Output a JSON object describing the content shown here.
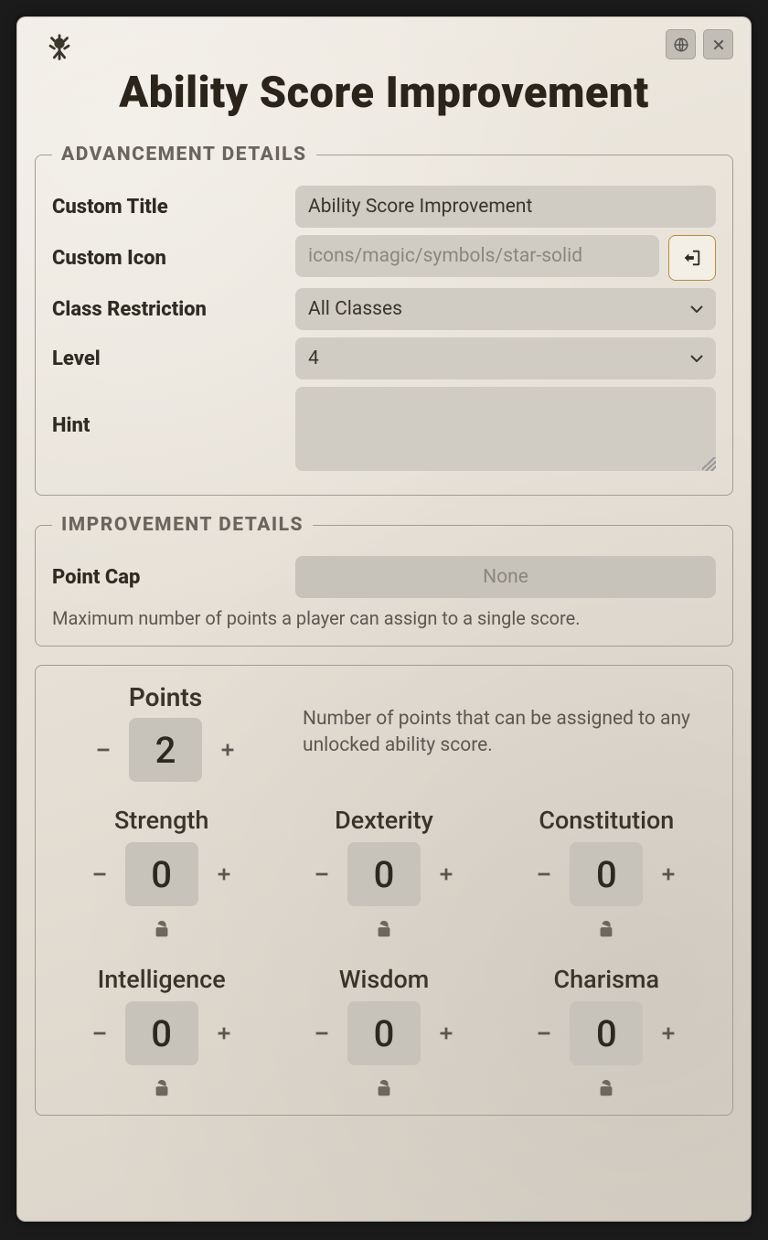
{
  "title": "Ability Score Improvement",
  "advancement": {
    "legend": "ADVANCEMENT DETAILS",
    "custom_title_label": "Custom Title",
    "custom_title_value": "Ability Score Improvement",
    "custom_icon_label": "Custom Icon",
    "custom_icon_placeholder": "icons/magic/symbols/star-solid",
    "class_restriction_label": "Class Restriction",
    "class_restriction_value": "All Classes",
    "level_label": "Level",
    "level_value": "4",
    "hint_label": "Hint"
  },
  "improvement": {
    "legend": "IMPROVEMENT DETAILS",
    "point_cap_label": "Point Cap",
    "point_cap_placeholder": "None",
    "point_cap_note": "Maximum number of points a player can assign to a single score."
  },
  "points": {
    "label": "Points",
    "value": "2",
    "note": "Number of points that can be assigned to any unlocked ability score."
  },
  "abilities": [
    {
      "name": "Strength",
      "value": "0"
    },
    {
      "name": "Dexterity",
      "value": "0"
    },
    {
      "name": "Constitution",
      "value": "0"
    },
    {
      "name": "Intelligence",
      "value": "0"
    },
    {
      "name": "Wisdom",
      "value": "0"
    },
    {
      "name": "Charisma",
      "value": "0"
    }
  ]
}
